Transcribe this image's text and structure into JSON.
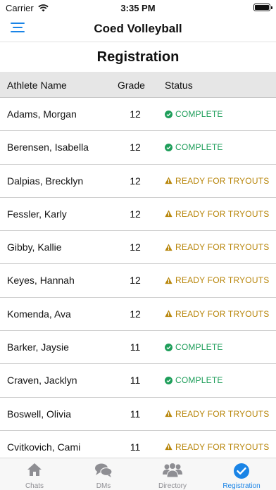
{
  "status_bar": {
    "carrier": "Carrier",
    "time": "3:35 PM"
  },
  "nav": {
    "title": "Coed Volleyball"
  },
  "page": {
    "title": "Registration"
  },
  "table": {
    "headers": {
      "name": "Athlete Name",
      "grade": "Grade",
      "status": "Status"
    },
    "rows": [
      {
        "name": "Adams, Morgan",
        "grade": "12",
        "status": "COMPLETE",
        "type": "complete"
      },
      {
        "name": "Berensen, Isabella",
        "grade": "12",
        "status": "COMPLETE",
        "type": "complete"
      },
      {
        "name": "Dalpias, Brecklyn",
        "grade": "12",
        "status": "READY FOR TRYOUTS",
        "type": "ready"
      },
      {
        "name": "Fessler, Karly",
        "grade": "12",
        "status": "READY FOR TRYOUTS",
        "type": "ready"
      },
      {
        "name": "Gibby, Kallie",
        "grade": "12",
        "status": "READY FOR TRYOUTS",
        "type": "ready"
      },
      {
        "name": "Keyes, Hannah",
        "grade": "12",
        "status": "READY FOR TRYOUTS",
        "type": "ready"
      },
      {
        "name": "Komenda, Ava",
        "grade": "12",
        "status": "READY FOR TRYOUTS",
        "type": "ready"
      },
      {
        "name": "Barker, Jaysie",
        "grade": "11",
        "status": "COMPLETE",
        "type": "complete"
      },
      {
        "name": "Craven, Jacklyn",
        "grade": "11",
        "status": "COMPLETE",
        "type": "complete"
      },
      {
        "name": "Boswell, Olivia",
        "grade": "11",
        "status": "READY FOR TRYOUTS",
        "type": "ready"
      },
      {
        "name": "Cvitkovich, Cami",
        "grade": "11",
        "status": "READY FOR TRYOUTS",
        "type": "ready"
      }
    ]
  },
  "tabs": [
    {
      "label": "Chats",
      "icon": "home-icon",
      "active": false
    },
    {
      "label": "DMs",
      "icon": "chat-bubbles-icon",
      "active": false
    },
    {
      "label": "Directory",
      "icon": "people-icon",
      "active": false
    },
    {
      "label": "Registration",
      "icon": "check-circle-icon",
      "active": true
    }
  ],
  "colors": {
    "accent": "#1a84e6",
    "complete": "#1e9e5a",
    "ready": "#b8860b"
  }
}
